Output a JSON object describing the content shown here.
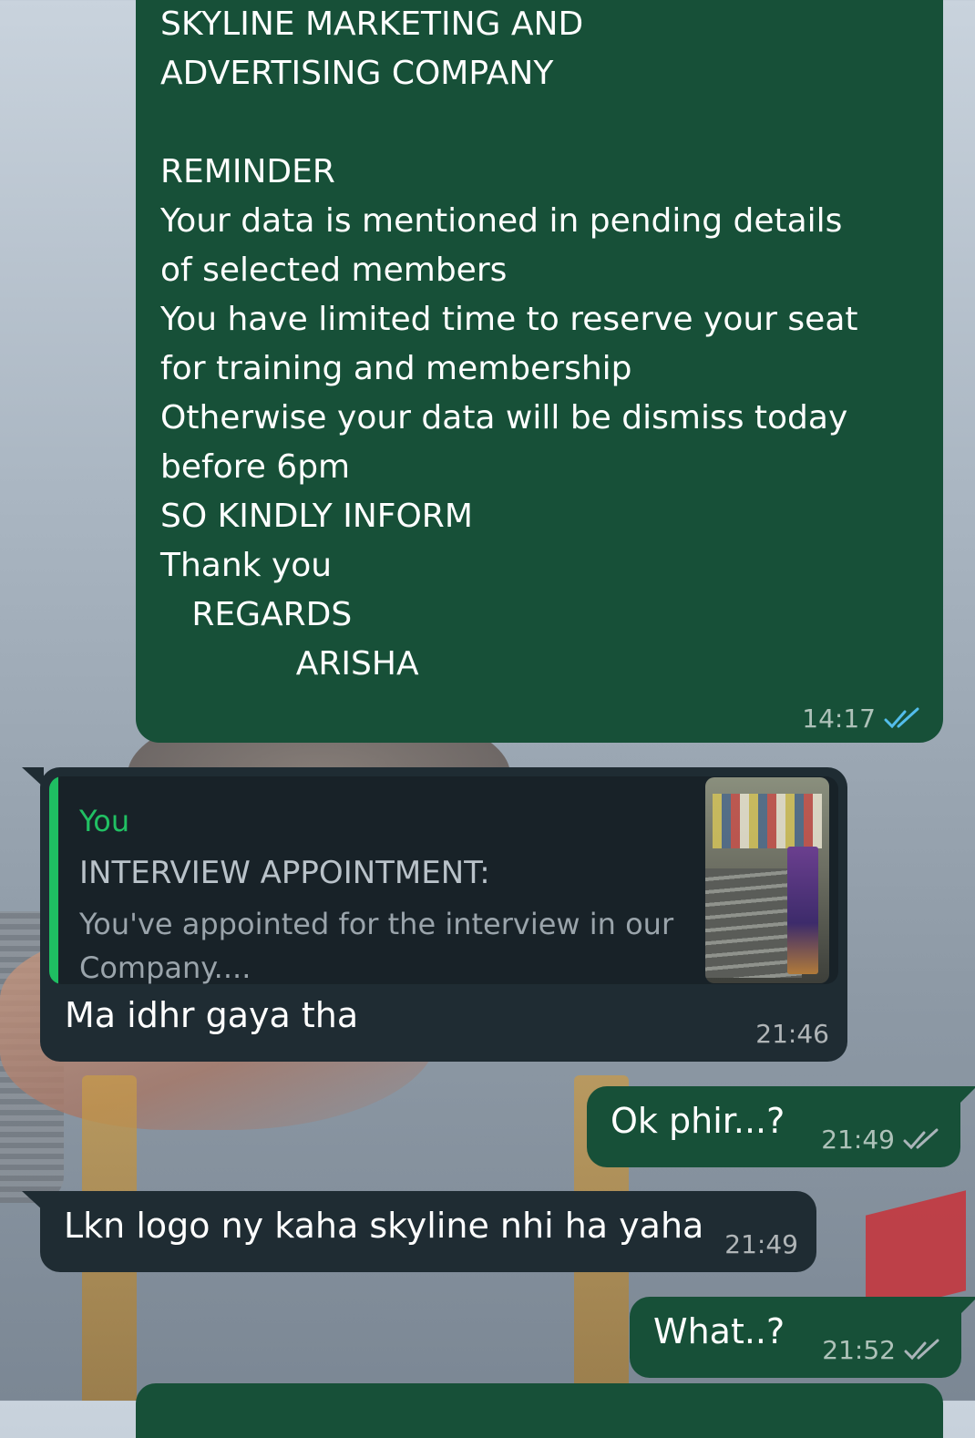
{
  "messages": {
    "reminder": {
      "text": "SKYLINE MARKETING AND\nADVERTISING COMPANY\n\nREMINDER\nYour data is mentioned in pending details\nof selected members\nYou have limited time to reserve your seat\nfor training and membership\nOtherwise your data will be dismiss today\nbefore 6pm\nSO KINDLY INFORM\nThank you\n   REGARDS\n             ARISHA",
      "time": "14:17",
      "status": "read",
      "tick_color": "#53bdeb"
    },
    "reply": {
      "quote_author": "You",
      "quote_title": "INTERVIEW APPOINTMENT:",
      "quote_body": "You've appointed for the interview in our Company....",
      "text": "Ma idhr gaya tha",
      "time": "21:46"
    },
    "ok": {
      "text": "Ok phir...?",
      "time": "21:49",
      "status": "delivered"
    },
    "lkn": {
      "text": "Lkn logo ny kaha skyline nhi ha yaha",
      "time": "21:49"
    },
    "what": {
      "text": "What..?",
      "time": "21:52",
      "status": "delivered"
    }
  },
  "colors": {
    "outgoing_bubble": "#175038",
    "incoming_bubble": "#1f2c33",
    "quote_accent": "#1fbe62",
    "read_ticks": "#53bdeb",
    "delivered_ticks": "#aab4b9"
  },
  "icons": {
    "read_receipt": "double-check-icon",
    "delivered_receipt": "double-check-icon"
  }
}
